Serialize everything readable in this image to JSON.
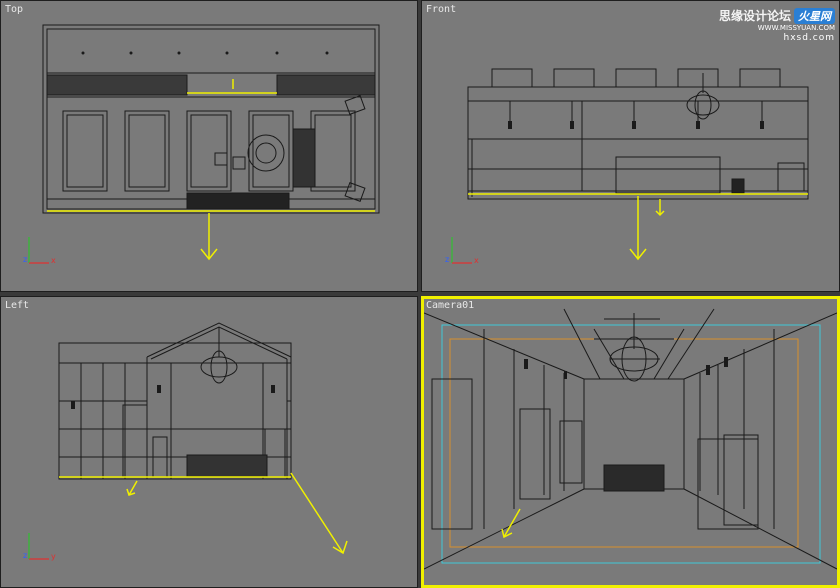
{
  "viewports": {
    "top": {
      "label": "Top"
    },
    "front": {
      "label": "Front"
    },
    "left": {
      "label": "Left"
    },
    "camera": {
      "label": "Camera01"
    }
  },
  "axis": {
    "x": "x",
    "y": "y",
    "z": "z"
  },
  "watermark": {
    "chinese": "思缘设计论坛",
    "logo": "火星网",
    "site_small": "WWW.MISSYUAN.COM",
    "site": "hxsd.com"
  },
  "colors": {
    "viewport_bg": "#7a7a7a",
    "wire": "#1a1a1a",
    "highlight": "#f0f000",
    "axis_x": "#e03030",
    "axis_y": "#30c030",
    "axis_z": "#3060ff",
    "safe_frame_cyan": "#40c8d8",
    "safe_frame_orange": "#d8902c"
  }
}
